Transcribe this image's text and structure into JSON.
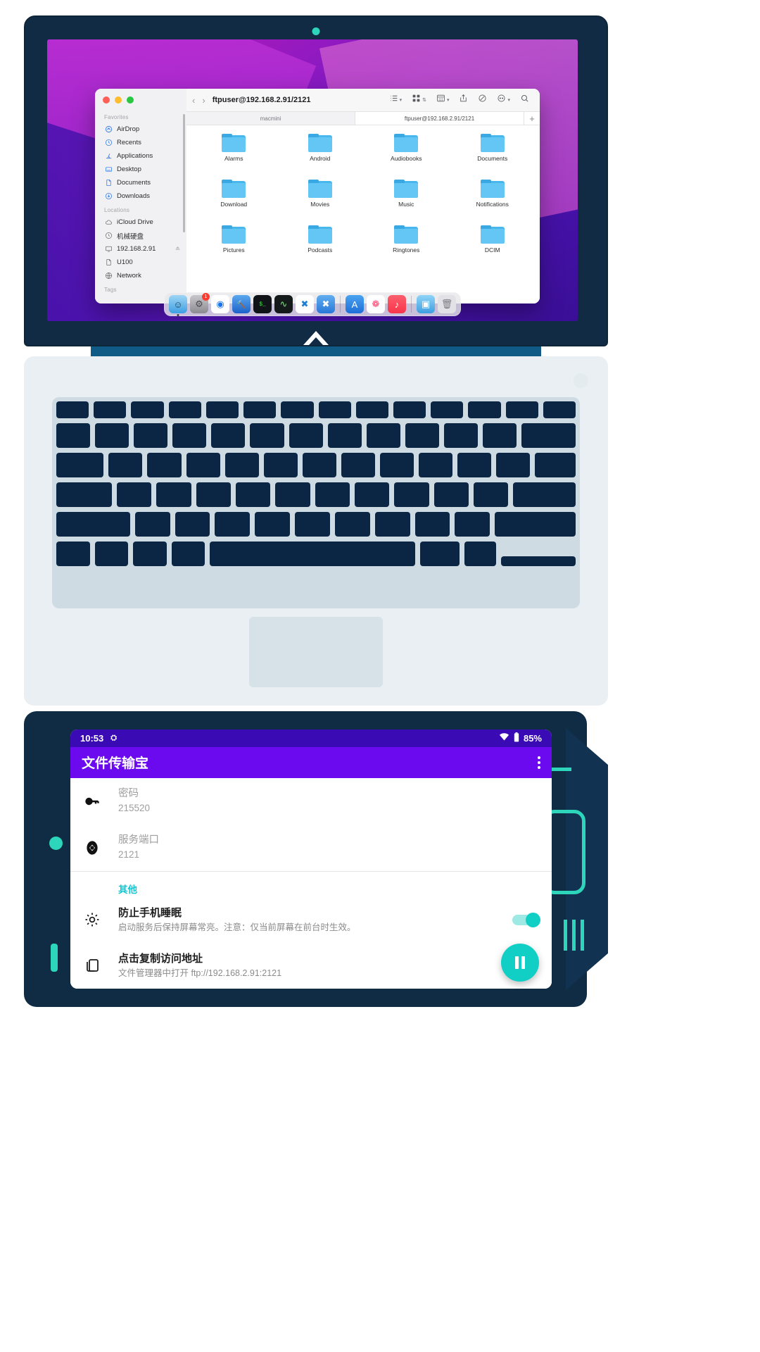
{
  "finder": {
    "path_title": "ftpuser@192.168.2.91/2121",
    "nav_back": "‹",
    "nav_forward": "›",
    "sidebar": {
      "groups": [
        {
          "title": "Favorites",
          "items": [
            {
              "label": "AirDrop",
              "icon": "airdrop-icon"
            },
            {
              "label": "Recents",
              "icon": "clock-icon"
            },
            {
              "label": "Applications",
              "icon": "applications-icon"
            },
            {
              "label": "Desktop",
              "icon": "desktop-icon"
            },
            {
              "label": "Documents",
              "icon": "document-icon"
            },
            {
              "label": "Downloads",
              "icon": "download-icon"
            }
          ]
        },
        {
          "title": "Locations",
          "items": [
            {
              "label": "iCloud Drive",
              "icon": "cloud-icon"
            },
            {
              "label": "机械硬盘",
              "icon": "clock-icon"
            },
            {
              "label": "192.168.2.91",
              "icon": "display-icon",
              "eject": true
            },
            {
              "label": "U100",
              "icon": "document-icon"
            },
            {
              "label": "Network",
              "icon": "globe-icon"
            }
          ]
        },
        {
          "title": "Tags",
          "items": []
        }
      ]
    },
    "tabs": [
      {
        "label": "macmini",
        "active": false
      },
      {
        "label": "ftpuser@192.168.2.91/2121",
        "active": true
      }
    ],
    "new_tab_label": "+",
    "toolbar_buttons": [
      {
        "name": "view-list-button",
        "icon": "list-view-icon"
      },
      {
        "name": "view-grid-button",
        "icon": "grid-view-icon"
      },
      {
        "name": "group-by-button",
        "icon": "group-icon"
      },
      {
        "name": "share-button",
        "icon": "share-icon"
      },
      {
        "name": "tags-button",
        "icon": "tag-icon"
      },
      {
        "name": "actions-button",
        "icon": "more-circle-icon"
      },
      {
        "name": "search-button",
        "icon": "search-icon"
      }
    ],
    "files": [
      "Alarms",
      "Android",
      "Audiobooks",
      "Documents",
      "Download",
      "Movies",
      "Music",
      "Notifications",
      "Pictures",
      "Podcasts",
      "Ringtones",
      "DCIM"
    ]
  },
  "dock": {
    "items": [
      {
        "name": "finder",
        "glyph": "☺",
        "bg": "#3d9fe3",
        "badge": null,
        "running": true
      },
      {
        "name": "system-settings",
        "glyph": "⚙",
        "bg": "#9a9a9f",
        "badge": "1",
        "running": false
      },
      {
        "name": "chrome",
        "glyph": "◉",
        "bg": "#ffffff",
        "badge": null,
        "running": false
      },
      {
        "name": "xcode",
        "glyph": "🔨",
        "bg": "#2b7de0",
        "badge": null,
        "running": false
      },
      {
        "name": "terminal",
        "glyph": "$_",
        "bg": "#101418",
        "badge": null,
        "running": false
      },
      {
        "name": "activity-monitor",
        "glyph": "∿",
        "bg": "#141a1a",
        "badge": null,
        "running": false
      },
      {
        "name": "vscode",
        "glyph": "✖",
        "bg": "#ffffff",
        "badge": null,
        "running": false
      },
      {
        "name": "remote-ssh",
        "glyph": "✖",
        "bg": "#3d8fe0",
        "badge": null,
        "running": false
      },
      {
        "name": "separator",
        "glyph": "",
        "bg": "",
        "badge": null,
        "running": false
      },
      {
        "name": "app-store",
        "glyph": "A",
        "bg": "#2f86e8",
        "badge": null,
        "running": false
      },
      {
        "name": "photos",
        "glyph": "❁",
        "bg": "#ffffff",
        "badge": null,
        "running": false
      },
      {
        "name": "music",
        "glyph": "♪",
        "bg": "#f8354a",
        "badge": null,
        "running": false
      },
      {
        "name": "separator2",
        "glyph": "",
        "bg": "",
        "badge": null,
        "running": false
      },
      {
        "name": "downloads-folder",
        "glyph": "▣",
        "bg": "#4aa8e8",
        "badge": null,
        "running": false
      },
      {
        "name": "trash",
        "glyph": "🗑",
        "bg": "#d8d8dc",
        "badge": null,
        "running": false
      }
    ]
  },
  "phone": {
    "status": {
      "time": "10:53",
      "ftp_icon": "ftp-notification-icon",
      "wifi_icon": "wifi-icon",
      "battery_icon": "battery-icon",
      "battery": "85%"
    },
    "appbar": {
      "title": "文件传输宝",
      "overflow": "more-vertical-icon"
    },
    "rows": [
      {
        "name": "password-row",
        "icon": "key-icon",
        "title": "密码",
        "value": "215520",
        "muted_title": true
      },
      {
        "name": "port-row",
        "icon": "port-icon",
        "title": "服务端口",
        "value": "2121",
        "muted_title": true
      }
    ],
    "section_other": "其他",
    "settings": [
      {
        "name": "keep-awake-row",
        "icon": "brightness-icon",
        "title": "防止手机睡眠",
        "subtitle": "启动服务后保持屏幕常亮。注意：仅当前屏幕在前台时生效。",
        "toggle": true,
        "toggle_on": true
      },
      {
        "name": "copy-address-row",
        "icon": "copy-icon",
        "title": "点击复制访问地址",
        "subtitle": "文件管理器中打开 ftp://192.168.2.91:2121",
        "toggle": false
      }
    ],
    "fab": {
      "name": "pause-service-button",
      "icon": "pause-icon"
    }
  },
  "colors": {
    "accent_teal": "#12cfc6",
    "appbar_purple": "#6b0aee",
    "statusbar_purple": "#3a0bb5",
    "section_label": "#13c7d4",
    "folder_blue": "#63c6f5"
  }
}
